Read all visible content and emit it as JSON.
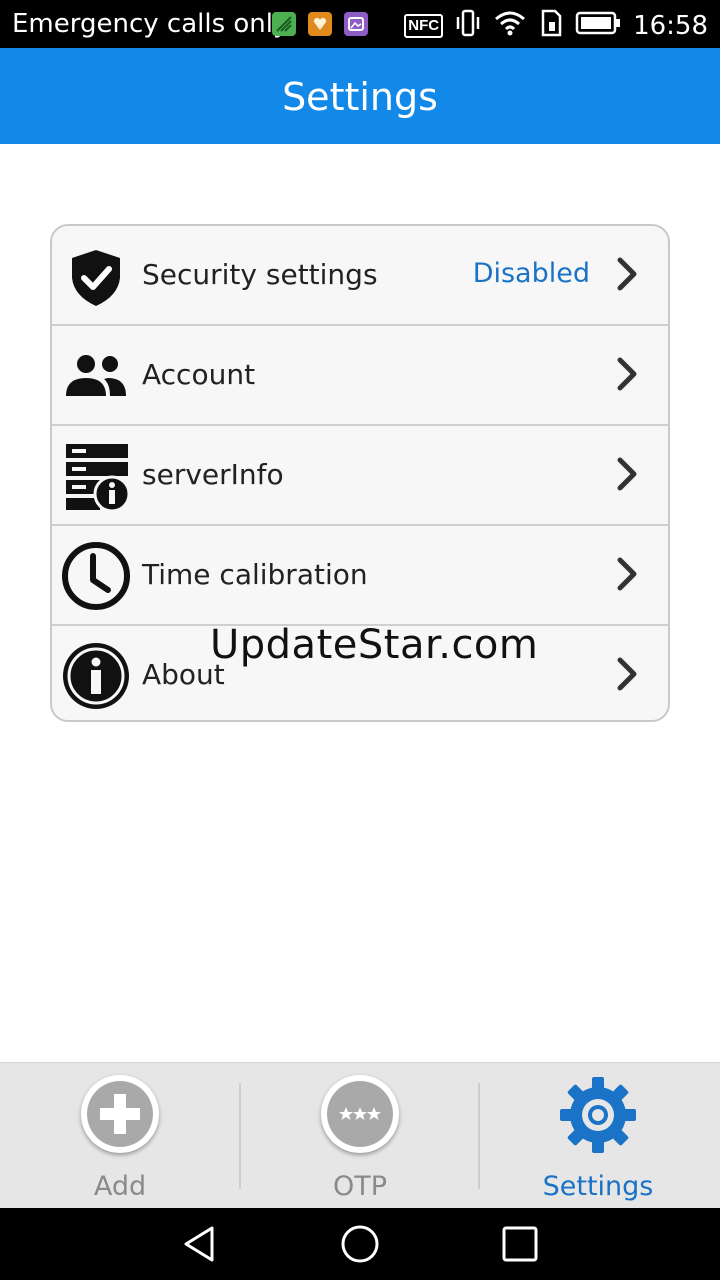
{
  "status_bar": {
    "carrier_text": "Emergency calls only",
    "nfc_label": "NFC",
    "time": "16:58",
    "icons": [
      "signal-app-icon",
      "notification-app-icon",
      "photo-app-icon",
      "nfc-icon",
      "vibrate-icon",
      "wifi-icon",
      "sim-icon",
      "battery-icon"
    ]
  },
  "app_bar": {
    "title": "Settings"
  },
  "settings": {
    "items": [
      {
        "label": "Security settings",
        "value": "Disabled",
        "icon": "shield-check-icon"
      },
      {
        "label": "Account",
        "value": "",
        "icon": "people-icon"
      },
      {
        "label": "serverInfo",
        "value": "",
        "icon": "server-info-icon"
      },
      {
        "label": "Time calibration",
        "value": "",
        "icon": "clock-icon"
      },
      {
        "label": "About",
        "value": "",
        "icon": "info-icon"
      }
    ]
  },
  "watermark": "UpdateStar.com",
  "tabs": [
    {
      "label": "Add",
      "icon": "plus-icon",
      "active": false
    },
    {
      "label": "OTP",
      "icon": "otp-dots-icon",
      "active": false
    },
    {
      "label": "Settings",
      "icon": "gear-icon",
      "active": true
    }
  ],
  "colors": {
    "app_bar": "#1289e8",
    "accent_text": "#1a73c6",
    "tab_bar": "#e6e6e6",
    "card_background": "#f7f7f7"
  }
}
